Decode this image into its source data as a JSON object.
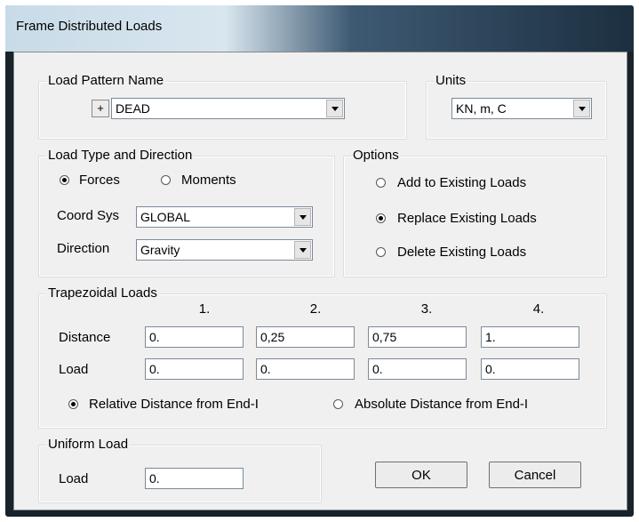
{
  "window": {
    "title": "Frame Distributed Loads"
  },
  "load_pattern": {
    "legend": "Load Pattern Name",
    "add_button_label": "+",
    "selected": "DEAD"
  },
  "units": {
    "legend": "Units",
    "selected": "KN, m, C"
  },
  "load_type": {
    "legend": "Load Type and Direction",
    "forces_label": "Forces",
    "moments_label": "Moments",
    "selected_type": "Forces",
    "coord_sys_label": "Coord Sys",
    "coord_sys_value": "GLOBAL",
    "direction_label": "Direction",
    "direction_value": "Gravity"
  },
  "options": {
    "legend": "Options",
    "add_label": "Add to Existing Loads",
    "replace_label": "Replace Existing Loads",
    "delete_label": "Delete Existing Loads",
    "selected": "Replace Existing Loads"
  },
  "trapezoidal": {
    "legend": "Trapezoidal Loads",
    "columns": [
      "1.",
      "2.",
      "3.",
      "4."
    ],
    "distance_label": "Distance",
    "load_label": "Load",
    "distances": [
      "0.",
      "0,25",
      "0,75",
      "1."
    ],
    "loads": [
      "0.",
      "0.",
      "0.",
      "0."
    ],
    "relative_label": "Relative Distance from End-I",
    "absolute_label": "Absolute Distance from End-I",
    "selected_mode": "Relative Distance from End-I"
  },
  "uniform": {
    "legend": "Uniform Load",
    "load_label": "Load",
    "value": "0."
  },
  "buttons": {
    "ok": "OK",
    "cancel": "Cancel"
  }
}
